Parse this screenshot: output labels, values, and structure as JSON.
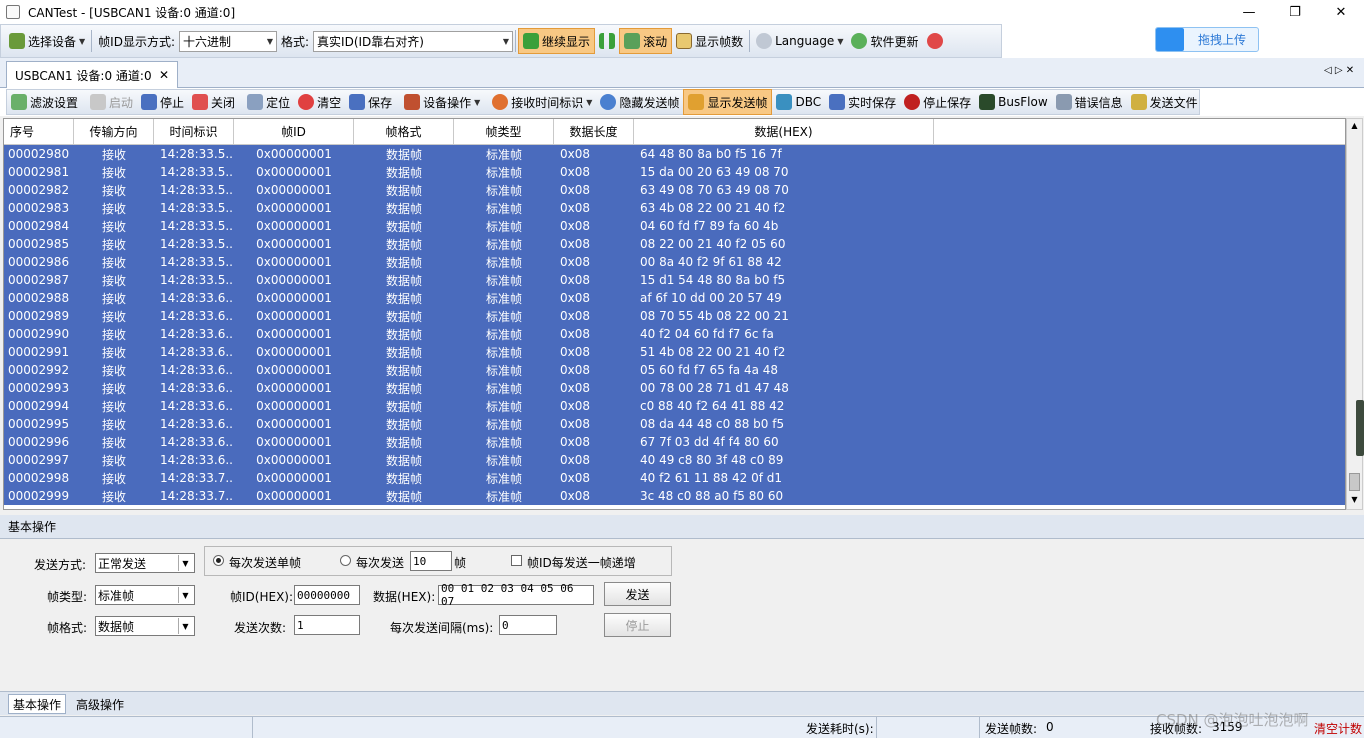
{
  "window": {
    "title": "CANTest  - [USBCAN1 设备:0 通道:0]",
    "minimize": "—",
    "maximize": "❐",
    "close": "✕"
  },
  "toolbar1": {
    "select_device": "选择设备",
    "id_format_label": "帧ID显示方式:",
    "id_format_value": "十六进制",
    "format_label": "格式:",
    "format_value": "真实ID(ID靠右对齐)",
    "continue_display": "继续显示",
    "scroll": "滚动",
    "show_frame_count": "显示帧数",
    "language": "Language",
    "software_update": "软件更新",
    "upload_button": "拖拽上传"
  },
  "tabs": {
    "device_tab": "USBCAN1 设备:0 通道:0",
    "close": "✕",
    "nav": "◁ ▷ ✕"
  },
  "toolbar2": {
    "filter_settings": "滤波设置",
    "start": "启动",
    "stop": "停止",
    "close": "关闭",
    "locate": "定位",
    "clear": "清空",
    "save": "保存",
    "device_ops": "设备操作",
    "recv_timestamp": "接收时间标识",
    "hide_send_frames": "隐藏发送帧",
    "show_send_frames": "显示发送帧",
    "dbc": "DBC",
    "realtime_save": "实时保存",
    "stop_save": "停止保存",
    "busflow": "BusFlow",
    "error_info": "错误信息",
    "send_file": "发送文件"
  },
  "grid": {
    "columns": [
      "序号",
      "传输方向",
      "时间标识",
      "帧ID",
      "帧格式",
      "帧类型",
      "数据长度",
      "数据(HEX)"
    ],
    "rows": [
      [
        "00002980",
        "接收",
        "14:28:33.5...",
        "0x00000001",
        "数据帧",
        "标准帧",
        "0x08",
        "64 48 80 8a b0 f5 16 7f"
      ],
      [
        "00002981",
        "接收",
        "14:28:33.5...",
        "0x00000001",
        "数据帧",
        "标准帧",
        "0x08",
        "15 da 00 20 63 49 08 70"
      ],
      [
        "00002982",
        "接收",
        "14:28:33.5...",
        "0x00000001",
        "数据帧",
        "标准帧",
        "0x08",
        "63 49 08 70 63 49 08 70"
      ],
      [
        "00002983",
        "接收",
        "14:28:33.5...",
        "0x00000001",
        "数据帧",
        "标准帧",
        "0x08",
        "63 4b 08 22 00 21 40 f2"
      ],
      [
        "00002984",
        "接收",
        "14:28:33.5...",
        "0x00000001",
        "数据帧",
        "标准帧",
        "0x08",
        "04 60 fd f7 89 fa 60 4b"
      ],
      [
        "00002985",
        "接收",
        "14:28:33.5...",
        "0x00000001",
        "数据帧",
        "标准帧",
        "0x08",
        "08 22 00 21 40 f2 05 60"
      ],
      [
        "00002986",
        "接收",
        "14:28:33.5...",
        "0x00000001",
        "数据帧",
        "标准帧",
        "0x08",
        "00 8a 40 f2 9f 61 88 42"
      ],
      [
        "00002987",
        "接收",
        "14:28:33.5...",
        "0x00000001",
        "数据帧",
        "标准帧",
        "0x08",
        "15 d1 54 48 80 8a b0 f5"
      ],
      [
        "00002988",
        "接收",
        "14:28:33.6...",
        "0x00000001",
        "数据帧",
        "标准帧",
        "0x08",
        "af 6f 10 dd 00 20 57 49"
      ],
      [
        "00002989",
        "接收",
        "14:28:33.6...",
        "0x00000001",
        "数据帧",
        "标准帧",
        "0x08",
        "08 70 55 4b 08 22 00 21"
      ],
      [
        "00002990",
        "接收",
        "14:28:33.6...",
        "0x00000001",
        "数据帧",
        "标准帧",
        "0x08",
        "40 f2 04 60 fd f7 6c fa"
      ],
      [
        "00002991",
        "接收",
        "14:28:33.6...",
        "0x00000001",
        "数据帧",
        "标准帧",
        "0x08",
        "51 4b 08 22 00 21 40 f2"
      ],
      [
        "00002992",
        "接收",
        "14:28:33.6...",
        "0x00000001",
        "数据帧",
        "标准帧",
        "0x08",
        "05 60 fd f7 65 fa 4a 48"
      ],
      [
        "00002993",
        "接收",
        "14:28:33.6...",
        "0x00000001",
        "数据帧",
        "标准帧",
        "0x08",
        "00 78 00 28 71 d1 47 48"
      ],
      [
        "00002994",
        "接收",
        "14:28:33.6...",
        "0x00000001",
        "数据帧",
        "标准帧",
        "0x08",
        "c0 88 40 f2 64 41 88 42"
      ],
      [
        "00002995",
        "接收",
        "14:28:33.6...",
        "0x00000001",
        "数据帧",
        "标准帧",
        "0x08",
        "08 da 44 48 c0 88 b0 f5"
      ],
      [
        "00002996",
        "接收",
        "14:28:33.6...",
        "0x00000001",
        "数据帧",
        "标准帧",
        "0x08",
        "67 7f 03 dd 4f f4 80 60"
      ],
      [
        "00002997",
        "接收",
        "14:28:33.6...",
        "0x00000001",
        "数据帧",
        "标准帧",
        "0x08",
        "40 49 c8 80 3f 48 c0 89"
      ],
      [
        "00002998",
        "接收",
        "14:28:33.7...",
        "0x00000001",
        "数据帧",
        "标准帧",
        "0x08",
        "40 f2 61 11 88 42 0f d1"
      ],
      [
        "00002999",
        "接收",
        "14:28:33.7...",
        "0x00000001",
        "数据帧",
        "标准帧",
        "0x08",
        "3c 48 c0 88 a0 f5 80 60"
      ]
    ]
  },
  "basic": {
    "panel_title": "基本操作",
    "send_mode_label": "发送方式:",
    "send_mode_value": "正常发送",
    "radio_single": "每次发送单帧",
    "radio_multi": "每次发送",
    "multi_count": "10",
    "frame_unit": "帧",
    "checkbox_increment": "帧ID每发送一帧递增",
    "frame_type_label": "帧类型:",
    "frame_type_value": "标准帧",
    "frame_id_label": "帧ID(HEX):",
    "frame_id_value": "00000000",
    "data_label": "数据(HEX):",
    "data_value": "00 01 02 03 04 05 06 07",
    "send_button": "发送",
    "frame_format_label": "帧格式:",
    "frame_format_value": "数据帧",
    "send_times_label": "发送次数:",
    "send_times_value": "1",
    "interval_label": "每次发送间隔(ms):",
    "interval_value": "0",
    "stop_button": "停止"
  },
  "bottom_tabs": {
    "basic": "基本操作",
    "advanced": "高级操作"
  },
  "status": {
    "send_time_label": "发送耗时(s):",
    "send_frames_label": "发送帧数:",
    "send_frames_value": "0",
    "recv_frames_label": "接收帧数:",
    "recv_frames_value": "3159",
    "clear_count": "清空计数",
    "watermark": "CSDN @泡泡吐泡泡啊"
  },
  "colors": {
    "row_bg": "#4a6bbd",
    "highlight": "#f8c884"
  }
}
